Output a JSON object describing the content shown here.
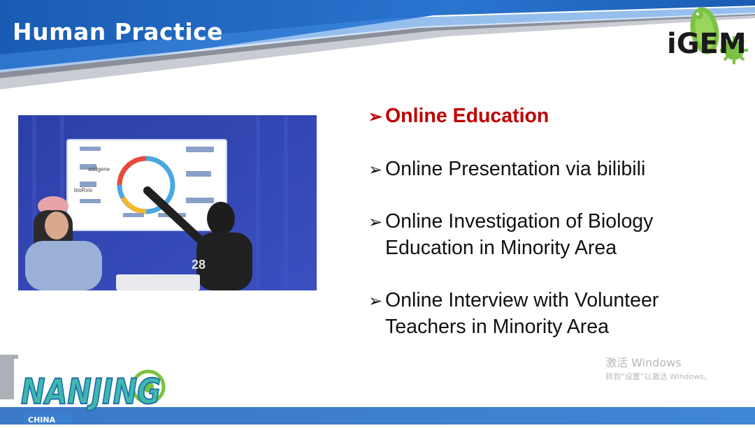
{
  "header": {
    "title": "Human Practice"
  },
  "logo": {
    "text": "iGEM"
  },
  "bullets": [
    {
      "text": "Online Education",
      "active": true
    },
    {
      "text": "Online Presentation via bilibili",
      "active": false
    },
    {
      "text": "Online Investigation of Biology\nEducation in Minority Area",
      "active": false
    },
    {
      "text": "Online Interview with Volunteer\nTeachers in Minority Area",
      "active": false
    }
  ],
  "watermark": {
    "title": "激活 Windows",
    "subtitle": "转到“设置”以激活 Windows。"
  },
  "team_logo": {
    "text": "NANJING",
    "sub": "CHINA"
  },
  "photo": {
    "description_icon": "presentation-photo"
  },
  "colors": {
    "header_blue": "#1f62b8",
    "header_dark": "#144f9e",
    "active_bullet": "#c00000",
    "bottom_bar": "#3b7fd0"
  }
}
